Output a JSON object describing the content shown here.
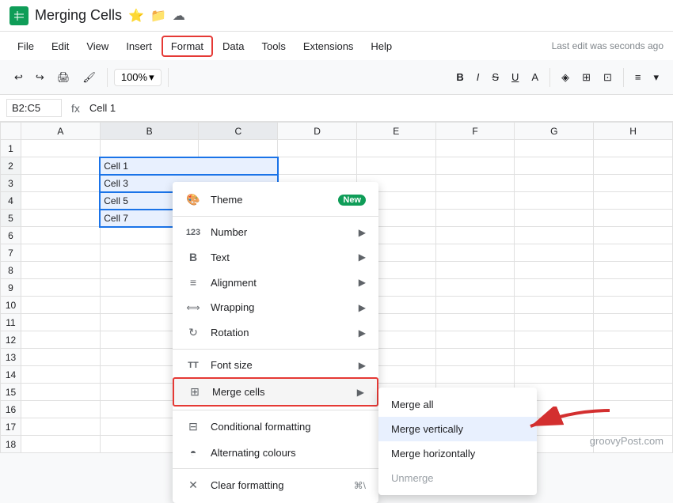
{
  "titleBar": {
    "appName": "Merging Cells",
    "starIcon": "⭐",
    "folderIcon": "📁",
    "cloudIcon": "☁"
  },
  "menuBar": {
    "items": [
      "File",
      "Edit",
      "View",
      "Insert",
      "Format",
      "Data",
      "Tools",
      "Extensions",
      "Help"
    ],
    "activeItem": "Format",
    "lastEdit": "Last edit was seconds ago"
  },
  "toolbar": {
    "undoLabel": "↩",
    "redoLabel": "↪",
    "printLabel": "🖨",
    "paintLabel": "🖌",
    "zoom": "100%",
    "zoomArrow": "▾"
  },
  "formulaBar": {
    "cellRef": "B2:C5",
    "fxIcon": "fx",
    "cellValue": "Cell 1"
  },
  "sheet": {
    "colHeaders": [
      "",
      "A",
      "B",
      "C",
      "D",
      "E",
      "F",
      "G",
      "H"
    ],
    "rows": [
      {
        "rowNum": "1",
        "cells": [
          "",
          "",
          "",
          "",
          "",
          "",
          "",
          ""
        ]
      },
      {
        "rowNum": "2",
        "cells": [
          "",
          "Cell 1",
          "",
          "",
          "",
          "",
          "",
          ""
        ]
      },
      {
        "rowNum": "3",
        "cells": [
          "",
          "Cell 3",
          "",
          "",
          "",
          "",
          "",
          ""
        ]
      },
      {
        "rowNum": "4",
        "cells": [
          "",
          "Cell 5",
          "",
          "",
          "",
          "",
          "",
          ""
        ]
      },
      {
        "rowNum": "5",
        "cells": [
          "",
          "Cell 7",
          "",
          "",
          "",
          "",
          "",
          ""
        ]
      },
      {
        "rowNum": "6",
        "cells": [
          "",
          "",
          "",
          "",
          "",
          "",
          "",
          ""
        ]
      },
      {
        "rowNum": "7",
        "cells": [
          "",
          "",
          "",
          "",
          "",
          "",
          "",
          ""
        ]
      },
      {
        "rowNum": "8",
        "cells": [
          "",
          "",
          "",
          "",
          "",
          "",
          "",
          ""
        ]
      },
      {
        "rowNum": "9",
        "cells": [
          "",
          "",
          "",
          "",
          "",
          "",
          "",
          ""
        ]
      },
      {
        "rowNum": "10",
        "cells": [
          "",
          "",
          "",
          "",
          "",
          "",
          "",
          ""
        ]
      },
      {
        "rowNum": "11",
        "cells": [
          "",
          "",
          "",
          "",
          "",
          "",
          "",
          ""
        ]
      },
      {
        "rowNum": "12",
        "cells": [
          "",
          "",
          "",
          "",
          "",
          "",
          "",
          ""
        ]
      },
      {
        "rowNum": "13",
        "cells": [
          "",
          "",
          "",
          "",
          "",
          "",
          "",
          ""
        ]
      },
      {
        "rowNum": "14",
        "cells": [
          "",
          "",
          "",
          "",
          "",
          "",
          "",
          ""
        ]
      },
      {
        "rowNum": "15",
        "cells": [
          "",
          "",
          "",
          "",
          "",
          "",
          "",
          ""
        ]
      },
      {
        "rowNum": "16",
        "cells": [
          "",
          "",
          "",
          "",
          "",
          "",
          "",
          ""
        ]
      },
      {
        "rowNum": "17",
        "cells": [
          "",
          "",
          "",
          "",
          "",
          "",
          "",
          ""
        ]
      },
      {
        "rowNum": "18",
        "cells": [
          "",
          "",
          "",
          "",
          "",
          "",
          "",
          ""
        ]
      }
    ]
  },
  "formatMenu": {
    "items": [
      {
        "icon": "🎨",
        "label": "Theme",
        "badge": "New",
        "arrow": "▶"
      },
      {
        "icon": "123",
        "label": "Number",
        "arrow": "▶"
      },
      {
        "icon": "B",
        "label": "Text",
        "arrow": "▶"
      },
      {
        "icon": "≡",
        "label": "Alignment",
        "arrow": "▶"
      },
      {
        "icon": "⟺",
        "label": "Wrapping",
        "arrow": "▶"
      },
      {
        "icon": "↻",
        "label": "Rotation",
        "arrow": "▶"
      },
      {
        "divider": true
      },
      {
        "icon": "TT",
        "label": "Font size",
        "arrow": "▶"
      },
      {
        "icon": "⊞",
        "label": "Merge cells",
        "arrow": "▶",
        "active": true
      },
      {
        "divider": true
      },
      {
        "icon": "⊟",
        "label": "Conditional formatting"
      },
      {
        "icon": "◓",
        "label": "Alternating colours"
      },
      {
        "divider": true
      },
      {
        "icon": "✕",
        "label": "Clear formatting",
        "kbd": "⌘\\"
      }
    ]
  },
  "mergeSubmenu": {
    "items": [
      {
        "label": "Merge all"
      },
      {
        "label": "Merge vertically",
        "highlighted": true
      },
      {
        "label": "Merge horizontally"
      },
      {
        "label": "Unmerge",
        "disabled": true
      }
    ]
  },
  "watermark": "groovyPost.com",
  "rightToolbar": {
    "boldIcon": "B",
    "italicIcon": "I",
    "strikeIcon": "S̶",
    "underlineIcon": "U",
    "fillIcon": "A",
    "borderIcon": "⊞",
    "mergeIcon": "⊡",
    "alignIcon": "≡"
  },
  "colors": {
    "selectedBg": "#e8f0fe",
    "selectedBorder": "#1a73e8",
    "activeMenuBorder": "#e53935",
    "greenBadge": "#0f9d58",
    "arrowColor": "#d32f2f"
  }
}
